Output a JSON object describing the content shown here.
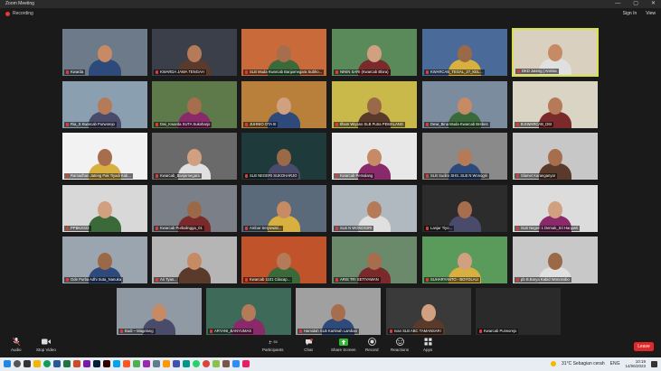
{
  "window": {
    "title": "Zoom Meeting",
    "min": "—",
    "max": "▢",
    "close": "✕"
  },
  "topbar": {
    "recording": "Recording",
    "sign_in": "Sign In",
    "view": "View"
  },
  "participants": [
    {
      "name": "Kwarda"
    },
    {
      "name": "KWARDA JAWA TENGAH"
    },
    {
      "name": "SLB Muda Kwarcab Banjarnegara Subho..."
    },
    {
      "name": "NININ SARI (Kwarcab Blora)"
    },
    {
      "name": "KWARCAB_TEGAL_27_KEL..."
    },
    {
      "name": "DKD Jateng | Annisa"
    },
    {
      "name": "Ria_S Kwarcab Purworejo"
    },
    {
      "name": "Dwi_Kwarda SUTA Sukoharjo"
    },
    {
      "name": "JUHNIO OTA III"
    },
    {
      "name": "Ilham Wiyano SLB Putra PEMALANG"
    },
    {
      "name": "Dewi_Bina Muda Kwarcab Brebes"
    },
    {
      "name": "B.KWARCAB_DM"
    },
    {
      "name": "Ramadhan Jateng Pak Tiyadi Kab..."
    },
    {
      "name": "Kwarcab_Banjarnegara"
    },
    {
      "name": "SLB NEGERI SUKOHARJO"
    },
    {
      "name": "Kwarcab Pemalang"
    },
    {
      "name": "SLB Sudiro SHS..SLB N Wonogiri"
    },
    {
      "name": "Slamet Karanganyar"
    },
    {
      "name": "PPBK2023"
    },
    {
      "name": "Kwarcab Purbalingga_01"
    },
    {
      "name": "Ambar Setyowati..."
    },
    {
      "name": "SLB N WONOGIRI"
    },
    {
      "name": "Lanjar Tiyo..."
    },
    {
      "name": "SLB Negeri 1 Demak_Sri Hanjanti"
    },
    {
      "name": "Gde Purba Adhi Suta_Nanuka"
    },
    {
      "name": "Ari Tyas..."
    },
    {
      "name": "Kwarcab 1101 Cilacap..."
    },
    {
      "name": "ARIS TRI SETIYAWAN"
    },
    {
      "name": "SUHARYANTO - BOYOLALI"
    },
    {
      "name": "pb B.Barya Kabid Wonosobo"
    },
    {
      "name": "Budi ~ Magelang"
    },
    {
      "name": "ARYANI_BANYUMAS"
    },
    {
      "name": "Hamidah SLB Kartinah Lamban"
    },
    {
      "name": "Ivan SLB ABC TAMANSARI"
    },
    {
      "name": "Kwarcab Purworejo"
    }
  ],
  "toolbar": {
    "audio": "Audio",
    "video": "Stop Video",
    "participants": "Participants",
    "participants_count": "35",
    "chat": "Chat",
    "share": "Share Screen",
    "record": "Record",
    "reactions": "Reactions",
    "apps": "Apps",
    "leave": "Leave"
  },
  "taskbar": {
    "weather": "31°C Sebagian cerah",
    "lang": "ENG",
    "time": "10:19",
    "date": "14/06/2023"
  },
  "colors": {
    "accent_border": "#d7e14a",
    "leave": "#e02828",
    "share": "#2eb82e",
    "record_dot": "#e53935"
  }
}
